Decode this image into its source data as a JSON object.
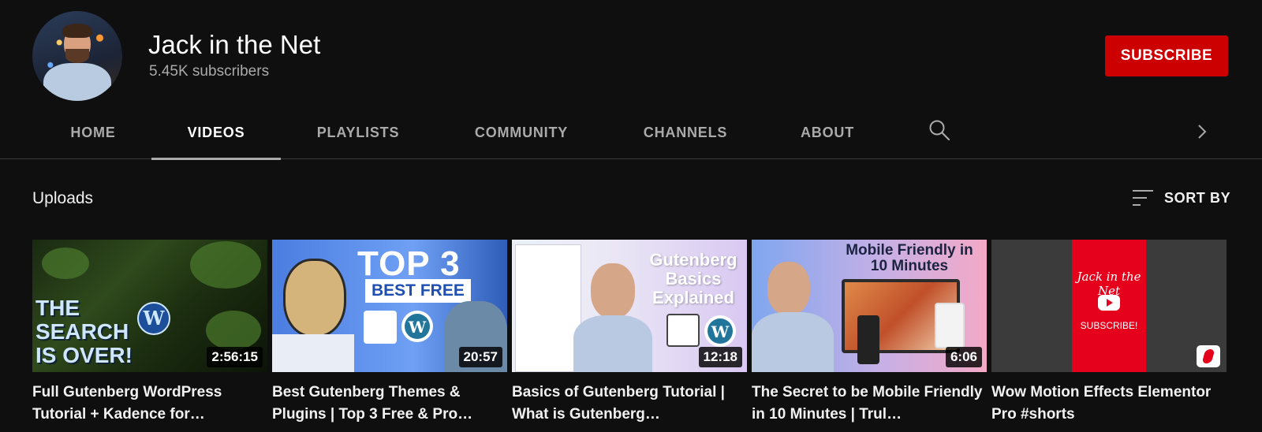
{
  "channel": {
    "name": "Jack in the Net",
    "subscribers": "5.45K subscribers",
    "subscribe_label": "SUBSCRIBE"
  },
  "tabs": [
    {
      "label": "HOME",
      "active": false
    },
    {
      "label": "VIDEOS",
      "active": true
    },
    {
      "label": "PLAYLISTS",
      "active": false
    },
    {
      "label": "COMMUNITY",
      "active": false
    },
    {
      "label": "CHANNELS",
      "active": false
    },
    {
      "label": "ABOUT",
      "active": false
    }
  ],
  "tab_icons": {
    "search": "search-icon",
    "next": "chevron-right-icon"
  },
  "section": {
    "title": "Uploads",
    "sort_label": "SORT BY",
    "sort_icon": "sort-icon"
  },
  "videos": [
    {
      "title": "Full Gutenberg WordPress Tutorial + Kadence for…",
      "duration": "2:56:15",
      "thumb_text": [
        "THE",
        "SEARCH",
        "IS OVER!"
      ]
    },
    {
      "title": "Best Gutenberg Themes & Plugins | Top 3 Free & Pro…",
      "duration": "20:57",
      "thumb_text": [
        "TOP 3",
        "BEST FREE"
      ]
    },
    {
      "title": "Basics of Gutenberg Tutorial | What is Gutenberg…",
      "duration": "12:18",
      "thumb_text": [
        "Gutenberg Basics Explained"
      ]
    },
    {
      "title": "The Secret to be Mobile Friendly in 10 Minutes | Trul…",
      "duration": "6:06",
      "thumb_text": [
        "Mobile Friendly in 10 Minutes"
      ]
    },
    {
      "title": "Wow Motion Effects Elementor Pro #shorts",
      "duration": "",
      "thumb_text": [
        "Jack in the Net",
        "SUBSCRIBE!"
      ],
      "badge_icon": "shorts-icon"
    }
  ],
  "colors": {
    "background": "#0f0f0f",
    "subscribe": "#cc0000",
    "text_primary": "#f1f1f1",
    "text_secondary": "#aaaaaa"
  }
}
